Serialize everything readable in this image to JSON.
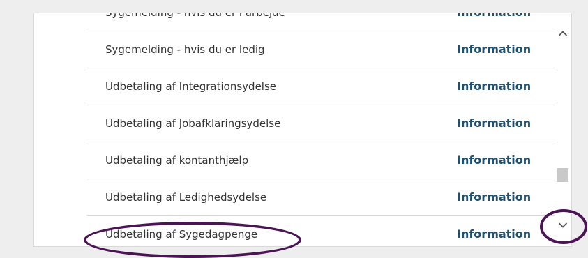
{
  "list": {
    "items": [
      {
        "label": "Sygemelding - hvis du er i arbejde",
        "link": "Information"
      },
      {
        "label": "Sygemelding - hvis du er ledig",
        "link": "Information"
      },
      {
        "label": "Udbetaling af Integrationsydelse",
        "link": "Information"
      },
      {
        "label": "Udbetaling af Jobafklaringsydelse",
        "link": "Information"
      },
      {
        "label": "Udbetaling af kontanthjælp",
        "link": "Information"
      },
      {
        "label": "Udbetaling af Ledighedsydelse",
        "link": "Information"
      },
      {
        "label": "Udbetaling af Sygedagpenge",
        "link": "Information"
      }
    ]
  },
  "scrollbar": {
    "up_icon": "chevron-up-icon",
    "down_icon": "chevron-down-icon"
  },
  "annotations": {
    "highlight_color": "#4b1454"
  }
}
